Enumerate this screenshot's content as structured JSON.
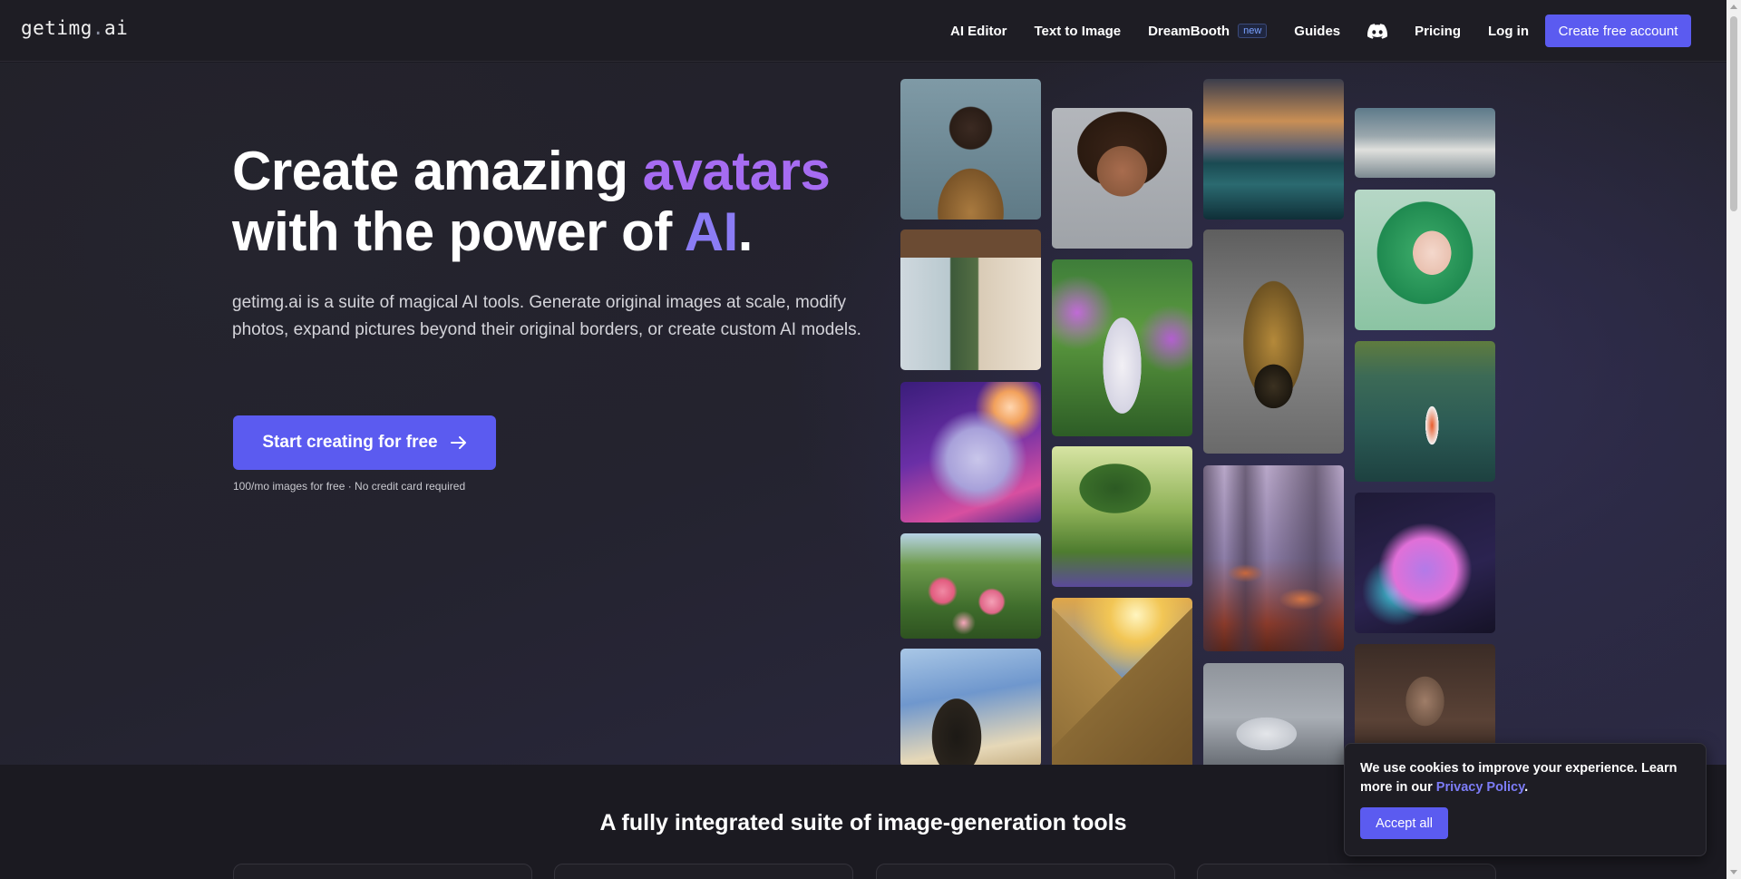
{
  "nav": {
    "logo_main": "getimg",
    "logo_dot": ".",
    "logo_suffix": "ai",
    "links": [
      {
        "label": "AI Editor"
      },
      {
        "label": "Text to Image"
      },
      {
        "label": "DreamBooth",
        "badge": "new"
      },
      {
        "label": "Guides"
      },
      {
        "label": "Pricing"
      },
      {
        "label": "Log in"
      }
    ],
    "discord_icon": "discord-icon",
    "cta_label": "Create free account"
  },
  "hero": {
    "title_line1_pre": "Create amazing ",
    "title_line1_accent": "avatars",
    "title_line2_pre": "with the power of ",
    "title_line2_accent": "AI",
    "title_line2_post": ".",
    "description": "getimg.ai is a suite of magical AI tools. Generate original images at scale, modify photos, expand pictures beyond their original borders, or create custom AI models.",
    "cta_label": "Start creating for free",
    "cta_icon": "arrow-right-icon",
    "note": "100/mo images for free · No credit card required"
  },
  "gallery": [
    {
      "name": "portrait-man-suit"
    },
    {
      "name": "bedroom-cabin"
    },
    {
      "name": "cosmic-cat"
    },
    {
      "name": "roses-garden"
    },
    {
      "name": "rider-horse"
    },
    {
      "name": "curly-man-portrait"
    },
    {
      "name": "flower-goddess"
    },
    {
      "name": "forest-tree"
    },
    {
      "name": "pyramid"
    },
    {
      "name": "stormy-sea"
    },
    {
      "name": "golden-skull"
    },
    {
      "name": "mushroom-forest"
    },
    {
      "name": "white-sneaker"
    },
    {
      "name": "clouds"
    },
    {
      "name": "green-anime-girl"
    },
    {
      "name": "koi-pond"
    },
    {
      "name": "neon-hamster"
    },
    {
      "name": "cyborg-woman"
    }
  ],
  "section2": {
    "title": "A fully integrated suite of image-generation tools"
  },
  "cookie": {
    "text_pre": "We use cookies to improve your experience. Learn more in our ",
    "link": "Privacy Policy",
    "text_post": ".",
    "accept_label": "Accept all"
  },
  "colors": {
    "accent": "#5b5bf0",
    "title_accent_1": "#a66cf2",
    "title_accent_2": "#8b7cf5",
    "background": "#1b1a22"
  }
}
